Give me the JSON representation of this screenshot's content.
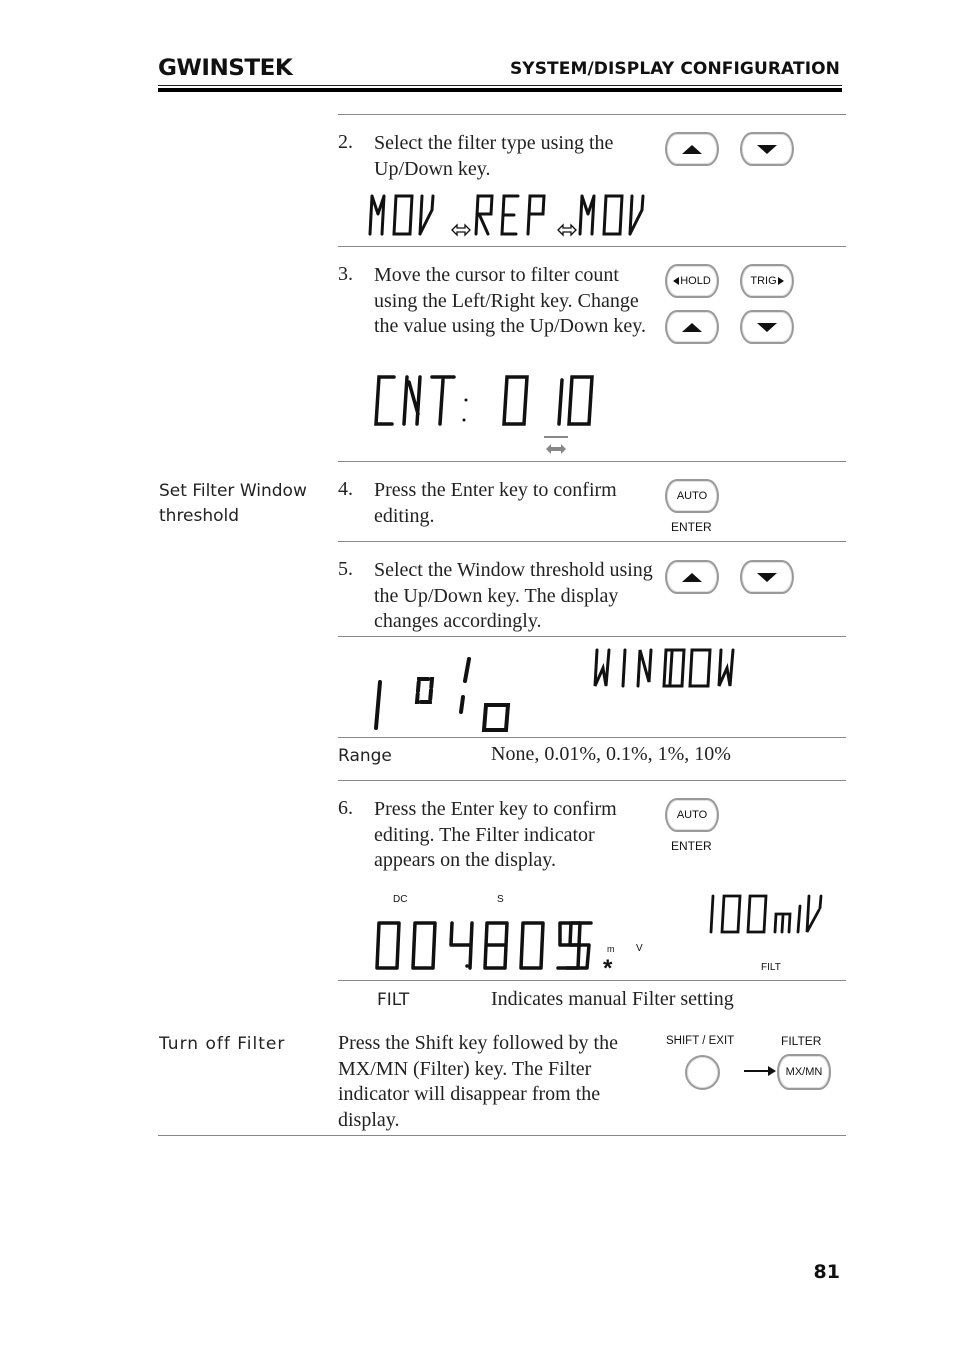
{
  "header": {
    "logo": "GWINSTEK",
    "section_title": "SYSTEM/DISPLAY CONFIGURATION"
  },
  "steps": [
    {
      "number": "2.",
      "text": "Select the filter type using the Up/Down key.",
      "keys": [
        "up-arrow",
        "down-arrow"
      ],
      "display": {
        "segments": [
          "MOV",
          "REP",
          "MOV"
        ],
        "separator_icon": "double-arrow-icon"
      }
    },
    {
      "number": "3.",
      "text": "Move the cursor to filter count using the Left/Right key. Change the value using the Up/Down key.",
      "keys": [
        {
          "label": "HOLD",
          "icon": "left-triangle-icon"
        },
        {
          "label": "TRIG",
          "icon": "right-triangle-icon"
        },
        "up-arrow",
        "down-arrow"
      ],
      "display": {
        "label": "CNT:",
        "value": "010",
        "cursor_icon": "left-right-arrow-icon"
      }
    },
    {
      "number": "4.",
      "text": "Press the Enter key to confirm editing.",
      "key": {
        "label": "AUTO",
        "caption": "ENTER"
      }
    },
    {
      "number": "5.",
      "text": "Select the Window threshold using the Up/Down key. The display changes accordingly.",
      "keys": [
        "up-arrow",
        "down-arrow"
      ],
      "display": {
        "main": "1%",
        "sub": "WINDOW"
      }
    },
    {
      "number": "6.",
      "text": "Press the Enter key to confirm editing. The Filter indicator appears on the display.",
      "key": {
        "label": "AUTO",
        "caption": "ENTER"
      },
      "display": {
        "annunciator_dc": "DC",
        "annunciator_s": "S",
        "reading": "004.8095",
        "unit_prefix": "m",
        "unit": "V",
        "star": "*",
        "range": "100mV",
        "filter_tag": "FILT"
      }
    }
  ],
  "side_labels": {
    "set_filter_window": "Set Filter Window threshold",
    "turn_off_filter": "Turn off Filter"
  },
  "range_row": {
    "label": "Range",
    "value": "None, 0.01%, 0.1%, 1%, 10%"
  },
  "filt_row": {
    "label": "FILT",
    "value": "Indicates manual Filter setting"
  },
  "turn_off": {
    "text": "Press the Shift key followed by the MX/MN (Filter) key. The Filter indicator will disappear from the display.",
    "shift_caption": "SHIFT / EXIT",
    "filter_caption": "FILTER",
    "filter_key_label": "MX/MN"
  },
  "page_number": "81"
}
